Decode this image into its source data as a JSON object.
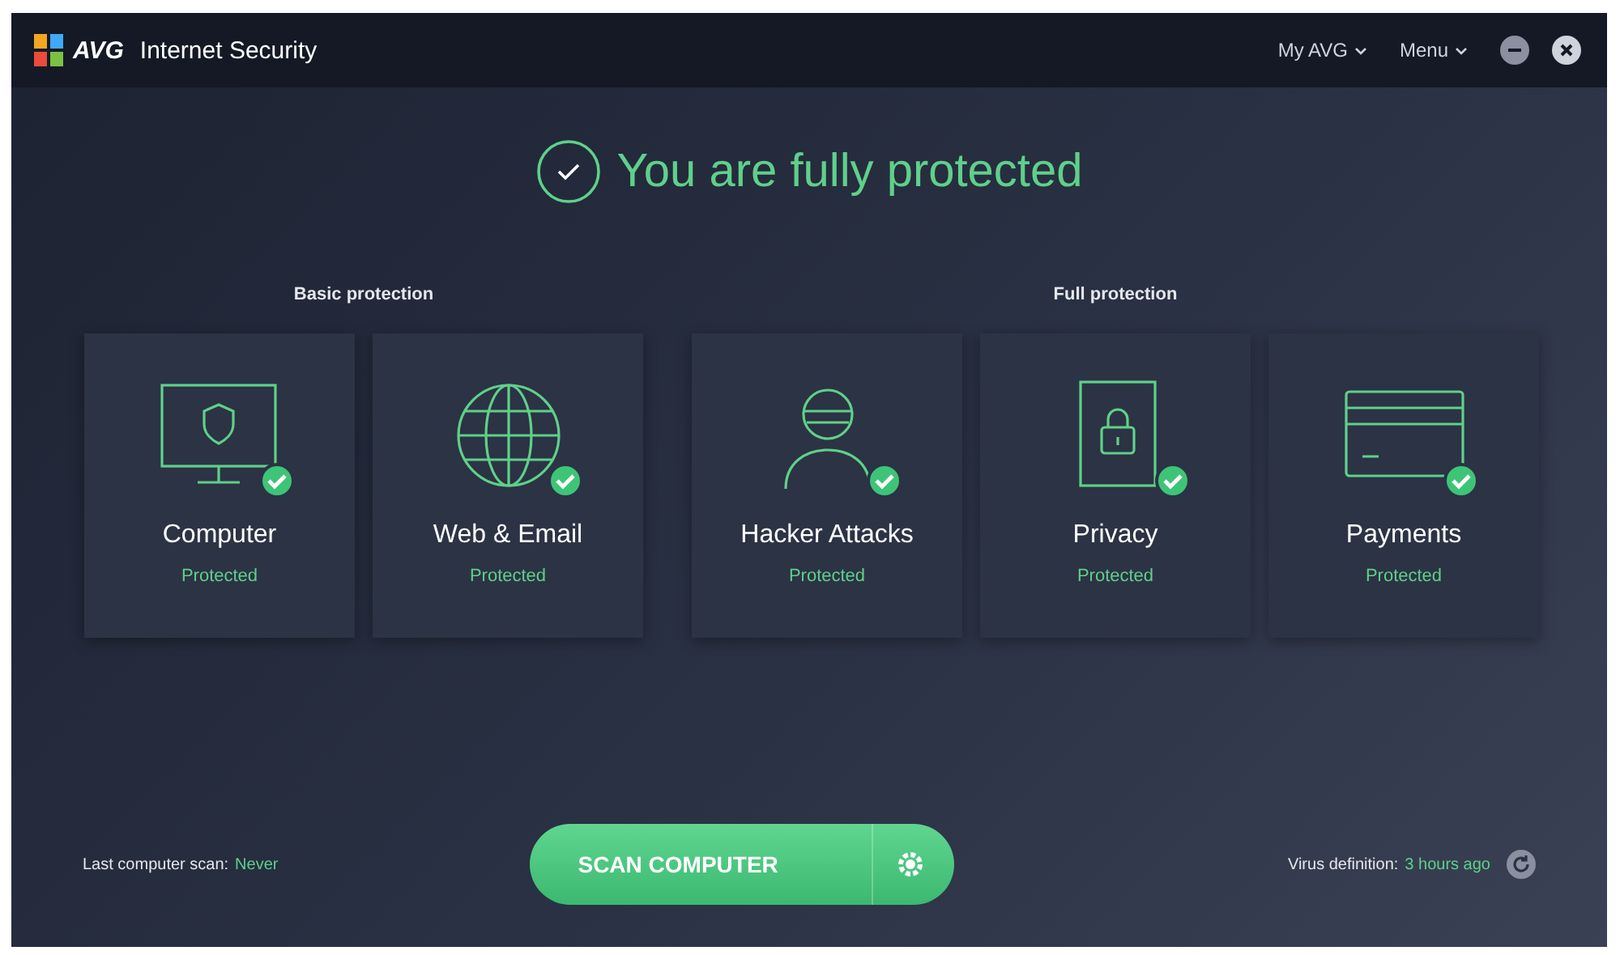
{
  "window": {
    "brand": "AVG",
    "title": "Internet Security",
    "menus": [
      {
        "label": "My AVG"
      },
      {
        "label": "Menu"
      }
    ]
  },
  "status": {
    "headline": "You are fully protected"
  },
  "groups": [
    {
      "title": "Basic protection",
      "cards": [
        {
          "kind": "monitor",
          "name": "Computer",
          "status": "Protected",
          "protected": true
        },
        {
          "kind": "globe",
          "name": "Web & Email",
          "status": "Protected",
          "protected": true
        }
      ]
    },
    {
      "title": "Full protection",
      "cards": [
        {
          "kind": "hacker",
          "name": "Hacker Attacks",
          "status": "Protected",
          "protected": true
        },
        {
          "kind": "lock",
          "name": "Privacy",
          "status": "Protected",
          "protected": true
        },
        {
          "kind": "card",
          "name": "Payments",
          "status": "Protected",
          "protected": true
        }
      ]
    }
  ],
  "footer": {
    "last_scan_label": "Last computer scan:",
    "last_scan_value": "Never",
    "scan_button": "SCAN COMPUTER",
    "virus_label": "Virus definition:",
    "virus_value": "3 hours ago"
  }
}
